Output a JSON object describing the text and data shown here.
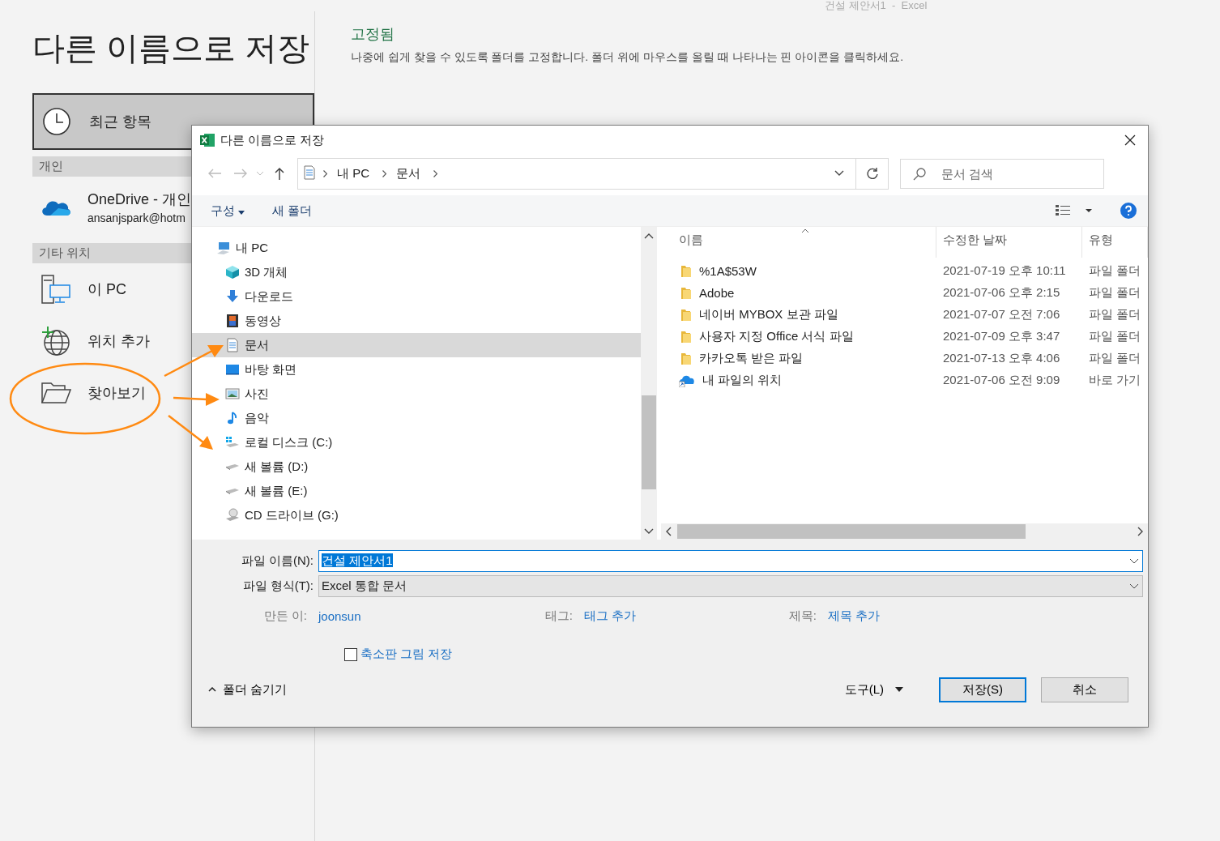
{
  "app_title": "건설 제안서1  -  Excel",
  "page_title": "다른 이름으로 저장",
  "recent": {
    "label": "최근 항목",
    "selected": true
  },
  "sections": [
    {
      "header": "개인",
      "items": [
        {
          "kind": "onedrive",
          "label": "OneDrive - 개인",
          "sublabel": "ansanjspark@hotm",
          "selected": false
        }
      ]
    },
    {
      "header": "기타 위치",
      "items": [
        {
          "kind": "pc",
          "label": "이 PC",
          "selected": false
        },
        {
          "kind": "add",
          "label": "위치 추가",
          "selected": false
        },
        {
          "kind": "browse",
          "label": "찾아보기",
          "selected": false
        }
      ]
    }
  ],
  "pinned": {
    "title": "고정됨",
    "hint": "나중에 쉽게 찾을 수 있도록 폴더를 고정합니다. 폴더 위에 마우스를 올릴 때 나타나는 핀 아이콘을 클릭하세요."
  },
  "dialog": {
    "title": "다른 이름으로 저장",
    "address": [
      "내 PC",
      "문서"
    ],
    "search": {
      "placeholder": "문서 검색"
    },
    "toolbar": {
      "organize": "구성",
      "new_folder": "새 폴더"
    },
    "tree": [
      {
        "label": "내 PC",
        "kind": "pc",
        "selected": false,
        "children": [
          {
            "label": "3D 개체",
            "kind": "cube",
            "selected": false
          },
          {
            "label": "다운로드",
            "kind": "download",
            "selected": false
          },
          {
            "label": "동영상",
            "kind": "video",
            "selected": false
          },
          {
            "label": "문서",
            "kind": "document",
            "selected": true
          },
          {
            "label": "바탕 화면",
            "kind": "desktop",
            "selected": false
          },
          {
            "label": "사진",
            "kind": "picture",
            "selected": false
          },
          {
            "label": "음악",
            "kind": "music",
            "selected": false
          },
          {
            "label": "로컬 디스크 (C:)",
            "kind": "windrive",
            "selected": false
          },
          {
            "label": "새 볼륨 (D:)",
            "kind": "drive",
            "selected": false
          },
          {
            "label": "새 볼륨 (E:)",
            "kind": "drive",
            "selected": false
          },
          {
            "label": "CD 드라이브 (G:)",
            "kind": "cd",
            "selected": false
          }
        ]
      }
    ],
    "columns": [
      "이름",
      "수정한 날짜",
      "유형"
    ],
    "files": [
      {
        "name": "%1A$53W",
        "date": "2021-07-19 오후 10:11",
        "type": "파일 폴더",
        "kind": "folder"
      },
      {
        "name": "Adobe",
        "date": "2021-07-06 오후 2:15",
        "type": "파일 폴더",
        "kind": "folder"
      },
      {
        "name": "네이버 MYBOX 보관 파일",
        "date": "2021-07-07 오전 7:06",
        "type": "파일 폴더",
        "kind": "folder"
      },
      {
        "name": "사용자 지정 Office 서식 파일",
        "date": "2021-07-09 오후 3:47",
        "type": "파일 폴더",
        "kind": "folder"
      },
      {
        "name": "카카오톡 받은 파일",
        "date": "2021-07-13 오후 4:06",
        "type": "파일 폴더",
        "kind": "folder"
      },
      {
        "name": "내 파일의 위치",
        "date": "2021-07-06 오전 9:09",
        "type": "바로 가기",
        "kind": "shortcut"
      }
    ],
    "filename": {
      "label": "파일 이름(N):",
      "value": "건설 제안서1"
    },
    "filetype": {
      "label": "파일 형식(T):",
      "value": "Excel 통합 문서"
    },
    "meta": [
      {
        "label": "만든 이:",
        "value": "joonsun"
      },
      {
        "label": "태그:",
        "value": "태그 추가"
      },
      {
        "label": "제목:",
        "value": "제목 추가"
      }
    ],
    "thumbnail": {
      "label": "축소판 그림 저장",
      "checked": false
    },
    "hide_folders": "폴더 숨기기",
    "tools": "도구(L)",
    "save": "저장(S)",
    "cancel": "취소"
  }
}
